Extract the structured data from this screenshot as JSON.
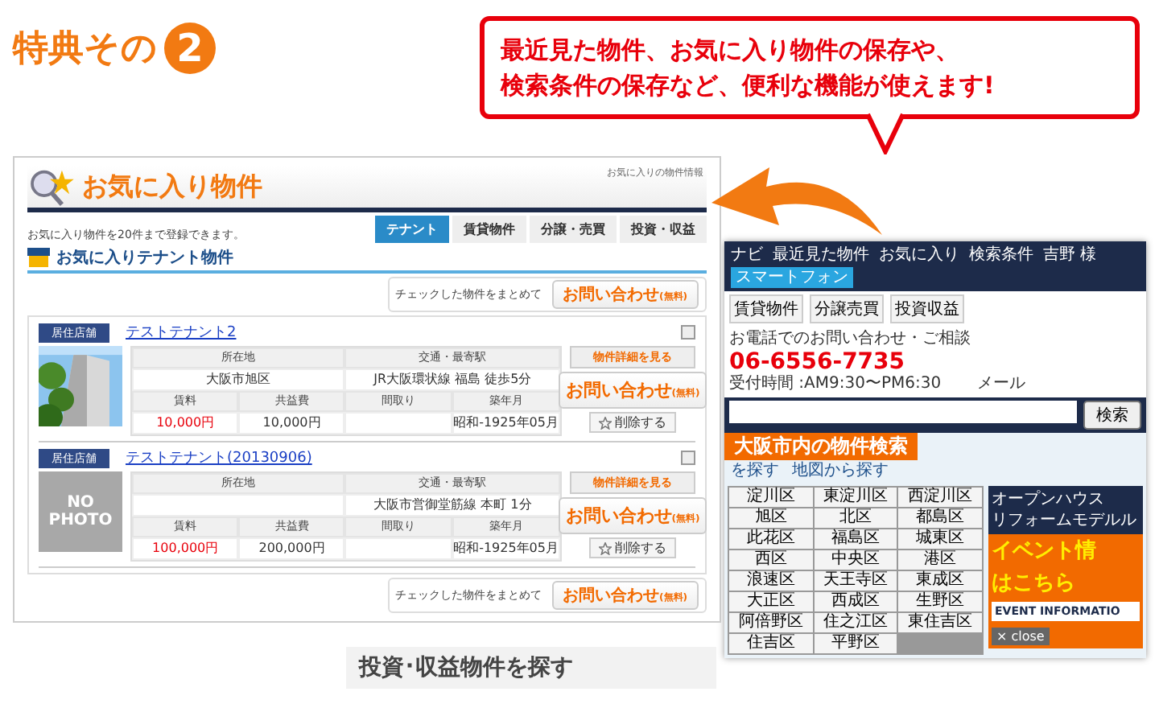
{
  "heading": {
    "label": "特典その",
    "number": "2"
  },
  "callout": {
    "lines": [
      "最近見た物件、お気に入り物件の保存や、",
      "検索条件の保存など、便利な機能が使えます!"
    ]
  },
  "front": {
    "title": "お気に入り物件",
    "breadcrumb": "お気に入りの物件情報",
    "note": "お気に入り物件を20件まで登録できます。",
    "tabs": [
      {
        "label": "テナント",
        "selected": true
      },
      {
        "label": "賃貸物件",
        "selected": false
      },
      {
        "label": "分譲・売買",
        "selected": false
      },
      {
        "label": "投資・収益",
        "selected": false
      }
    ],
    "section_title": "お気に入りテナント物件",
    "bulk_top": {
      "label": "チェックした物件をまとめて",
      "button": "お問い合わせ",
      "tag": "(無料)"
    },
    "items": [
      {
        "category": "居住店舗",
        "name": "テストテナント2",
        "checked": false,
        "headers": [
          "所在地",
          "交通・最寄駅",
          "賃料",
          "共益費",
          "間取り",
          "築年月"
        ],
        "address": "大阪市旭区",
        "transit": "JR大阪環状線 福島 徒歩5分",
        "rent": "10,000円",
        "common_fee": "10,000円",
        "built": "昭和-1925年05月",
        "detail_button": "物件詳細を見る",
        "inquiry_button": "お問い合わせ",
        "inquiry_tag": "(無料)",
        "delete_button": "削除する"
      },
      {
        "category": "居住店舗",
        "name": "テストテナント(20130906)",
        "checked": false,
        "photo": {
          "kind": "none",
          "text": "NO PHOTO"
        },
        "headers": [
          "所在地",
          "交通・最寄駅",
          "賃料",
          "共益費",
          "間取り",
          "築年月"
        ],
        "transit": "大阪市営御堂筋線 本町 1分",
        "rent": "100,000円",
        "common_fee": "200,000円",
        "built": "昭和-1925年05月",
        "detail_button": "物件詳細を見る",
        "inquiry_button": "お問い合わせ",
        "inquiry_tag": "(無料)",
        "delete_button": "削除する"
      }
    ],
    "bulk_bottom": {
      "label": "チェックした物件をまとめて",
      "button": "お問い合わせ",
      "tag": "(無料)"
    }
  },
  "back": {
    "brand": "ナビ",
    "nav": [
      "最近見た物件",
      "お気に入り",
      "検索条件"
    ],
    "user": "吉野 様",
    "smartphone": "スマートフォン",
    "categories": [
      "賃貸物件",
      "分譲売買",
      "投資収益"
    ],
    "phone_label": "お電話でのお問い合わせ・ご相談",
    "phone": "06-6556-7735",
    "hours": "受付時間 :AM9:30〜PM6:30",
    "mail": "メール",
    "search_button": "検索",
    "banner": "大阪市内の物件検索",
    "side_links": [
      "を探す",
      "地図から探す"
    ],
    "wards": [
      "淀川区",
      "東淀川区",
      "西淀川区",
      "旭区",
      "北区",
      "都島区",
      "此花区",
      "福島区",
      "城東区",
      "西区",
      "中央区",
      "港区",
      "浪速区",
      "天王寺区",
      "東成区",
      "大正区",
      "西成区",
      "生野区",
      "阿倍野区",
      "住之江区",
      "東住吉区",
      "住吉区",
      "平野区"
    ],
    "event": {
      "lines": [
        "オープンハウス",
        "リフォームモデルル"
      ],
      "headline": [
        "イベント情",
        "はこちら"
      ],
      "button": "EVENT INFORMATIO",
      "close": "× close"
    },
    "bottom_link": "投資･収益物件を探す"
  }
}
